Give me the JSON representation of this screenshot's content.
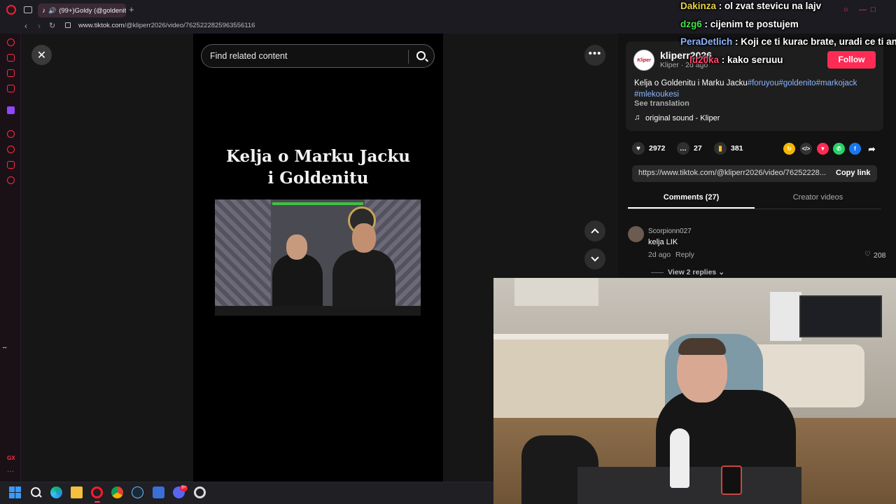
{
  "browser": {
    "tab_title": "(99+)Goldy (@goldenit",
    "new_tab": "+",
    "url_host": "www.tiktok.com",
    "url_path": "/@kliperr2026/video/7625222825963556116"
  },
  "search": {
    "placeholder": "Find related content"
  },
  "video": {
    "title_line1": "Kelja o Marku Jacku",
    "title_line2": "i Goldenitu"
  },
  "post": {
    "avatar_text": "Kliper",
    "username": "kliperr2026",
    "subname": "Kliper · 2d ago",
    "follow_label": "Follow",
    "caption_text": "Kelja o Goldenitu i Marku Jacku",
    "hashtags": [
      "#foruyou",
      "#goldenito",
      "#markojack",
      "#mlekoukesi"
    ],
    "see_translation": "See translation",
    "sound": "original sound - Kliper",
    "likes": "2972",
    "comments": "27",
    "saves": "381",
    "link_url": "https://www.tiktok.com/@kliperr2026/video/76252228...",
    "copy_link_label": "Copy link"
  },
  "tabs": {
    "comments_label": "Comments (27)",
    "creator_label": "Creator videos"
  },
  "comment": {
    "user": "Scorpionn027",
    "text": "kelja LIK",
    "time": "2d ago",
    "reply_label": "Reply",
    "likes": "208",
    "view_replies": "View 2 replies"
  },
  "chat": [
    {
      "nick": "Dakinza",
      "nick_color": "#e6d44a",
      "message": " : ol zvat stevicu na lajv"
    },
    {
      "nick": "dzg6",
      "nick_color": "#49e04a",
      "message": " : cijenim te postujem"
    },
    {
      "nick": "PeraDetlich",
      "nick_color": "#8fb4ff",
      "message": " : Koji ce ti kurac brate, uradi ce ti an"
    },
    {
      "nick": "lu20ka",
      "nick_color": "#ff4a6d",
      "message": " : kako seruuu"
    }
  ],
  "taskbar": {
    "discord_badge": "9+"
  },
  "sidebar": {
    "gx_label": "GX"
  },
  "colors": {
    "follow": "#fe2c55",
    "hashtag": "#8db7ff",
    "opera": "#ff1b2d"
  },
  "icons": [
    "close-icon",
    "search-icon",
    "more-icon",
    "chevron-up-icon",
    "chevron-down-icon",
    "heart-icon",
    "comment-icon",
    "bookmark-icon",
    "music-icon"
  ]
}
